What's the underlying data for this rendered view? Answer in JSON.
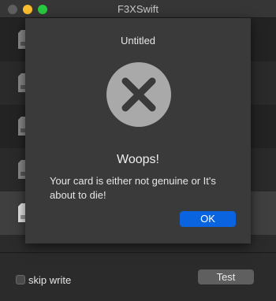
{
  "window": {
    "title": "F3XSwift"
  },
  "dialog": {
    "title": "Untitled",
    "heading": "Woops!",
    "message": "Your card is either not genuine or It's about to die!",
    "ok_label": "OK",
    "icon": "error-x-icon"
  },
  "footer": {
    "skip_write_label": "skip write",
    "skip_write_checked": false,
    "test_label": "Test"
  },
  "colors": {
    "accent": "#0a64e0",
    "traffic_close": "#5e5e5e",
    "traffic_minimize": "#fbbd2e",
    "traffic_maximize": "#2ac840"
  }
}
